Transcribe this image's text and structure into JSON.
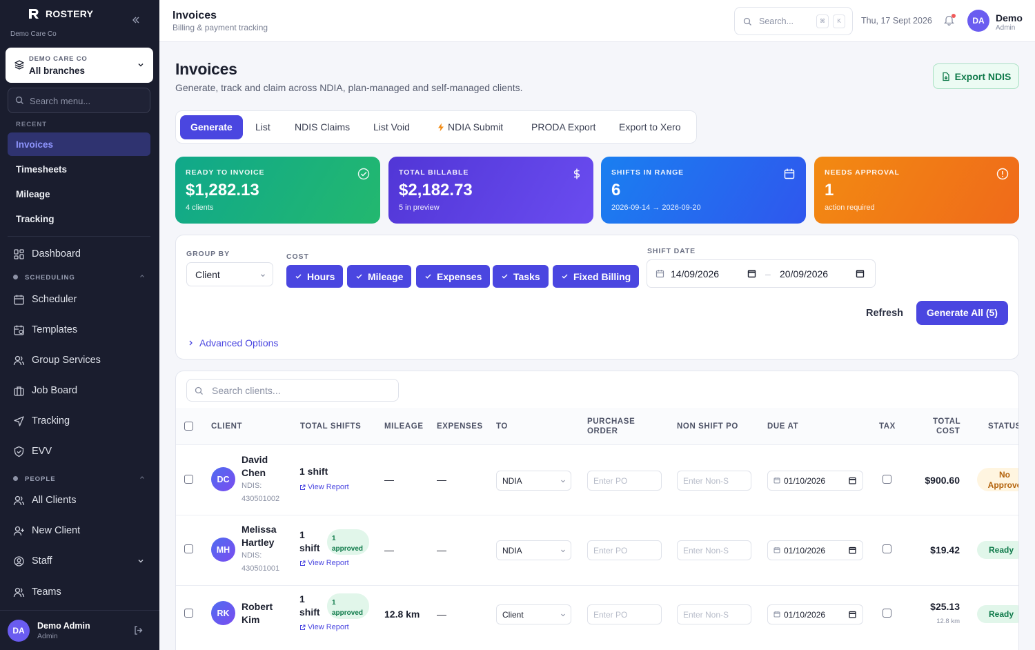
{
  "sidebar": {
    "brand": "ROSTERY",
    "org": "Demo Care Co",
    "branch_org": "DEMO CARE CO",
    "branch_name": "All branches",
    "search_placeholder": "Search menu...",
    "recent_label": "RECENT",
    "recent": [
      "Invoices",
      "Timesheets",
      "Mileage",
      "Tracking"
    ],
    "dashboard": "Dashboard",
    "scheduling_label": "SCHEDULING",
    "scheduling": [
      "Scheduler",
      "Templates",
      "Group Services",
      "Job Board",
      "Tracking",
      "EVV"
    ],
    "people_label": "PEOPLE",
    "people": [
      "All Clients",
      "New Client",
      "Staff",
      "Teams"
    ],
    "user_initials": "DA",
    "user_name": "Demo Admin",
    "user_role": "Admin"
  },
  "topbar": {
    "title": "Invoices",
    "subtitle": "Billing & payment tracking",
    "search_placeholder": "Search...",
    "kbd1": "⌘",
    "kbd2": "K",
    "date": "Thu, 17 Sept 2026",
    "user_initials": "DA",
    "user_name": "Demo",
    "user_role": "Admin"
  },
  "page": {
    "title": "Invoices",
    "subtitle": "Generate, track and claim across NDIA, plan-managed and self-managed clients.",
    "export_label": "Export NDIS"
  },
  "tabs": [
    "Generate",
    "List",
    "NDIS Claims",
    "List Void",
    "NDIA Submit",
    "PRODA Export",
    "Export to Xero"
  ],
  "cards": [
    {
      "label": "READY TO INVOICE",
      "value": "$1,282.13",
      "sub": "4 clients",
      "color": "#10a88a"
    },
    {
      "label": "TOTAL BILLABLE",
      "value": "$2,182.73",
      "sub": "5 in preview",
      "color": "#5a3fe0"
    },
    {
      "label": "SHIFTS IN RANGE",
      "value": "6",
      "sub": "2026-09-14 → 2026-09-20",
      "color": "#2568ef"
    },
    {
      "label": "NEEDS APPROVAL",
      "value": "1",
      "sub": "action required",
      "color": "#f27d15"
    }
  ],
  "filters": {
    "group_by_label": "GROUP BY",
    "group_by": "Client",
    "cost_label": "COST",
    "chips": [
      "Hours",
      "Mileage",
      "Expenses",
      "Tasks",
      "Fixed Billing"
    ],
    "shift_date_label": "SHIFT DATE",
    "date_from": "14/09/2026",
    "date_to": "20/09/2026",
    "range_sep": "–",
    "refresh": "Refresh",
    "generate_all": "Generate All (5)",
    "advanced": "Advanced Options"
  },
  "table": {
    "search_placeholder": "Search clients...",
    "headers": {
      "client": "CLIENT",
      "total_shifts": "TOTAL SHIFTS",
      "mileage": "MILEAGE",
      "expenses": "EXPENSES",
      "to": "TO",
      "po1": "PURCHASE",
      "po2": "ORDER",
      "non_shift_po": "NON SHIFT PO",
      "due_at": "DUE AT",
      "tax": "TAX",
      "cost1": "TOTAL",
      "cost2": "COST",
      "status": "STATUS"
    },
    "po_placeholder": "Enter PO",
    "nonpo_placeholder": "Enter Non-S",
    "view_report": "View Report",
    "rows": [
      {
        "initials": "DC",
        "first": "David",
        "last": "Chen",
        "ndis_label": "NDIS:",
        "ndis": "430501002",
        "shift_count": "1 shift",
        "approved": false,
        "mileage": "—",
        "expenses": "—",
        "to": "NDIA",
        "due": "01/10/2026",
        "cost": "$900.60",
        "cost_sub": "",
        "status1": "No",
        "status2": "Approve"
      },
      {
        "initials": "MH",
        "first": "Melissa",
        "last": "Hartley",
        "ndis_label": "NDIS:",
        "ndis": "430501001",
        "shift_n": "1",
        "shift_w": "shift",
        "appr_n": "1",
        "appr_w": "approved",
        "mileage": "—",
        "expenses": "—",
        "to": "NDIA",
        "due": "01/10/2026",
        "cost": "$19.42",
        "cost_sub": "",
        "status": "Ready"
      },
      {
        "initials": "RK",
        "first": "Robert",
        "last": "Kim",
        "shift_n": "1",
        "shift_w": "shift",
        "appr_n": "1",
        "appr_w": "approved",
        "mileage": "12.8 km",
        "expenses": "—",
        "to": "Client",
        "due": "01/10/2026",
        "cost": "$25.13",
        "cost_sub": "12.8 km",
        "status": "Ready"
      }
    ]
  }
}
